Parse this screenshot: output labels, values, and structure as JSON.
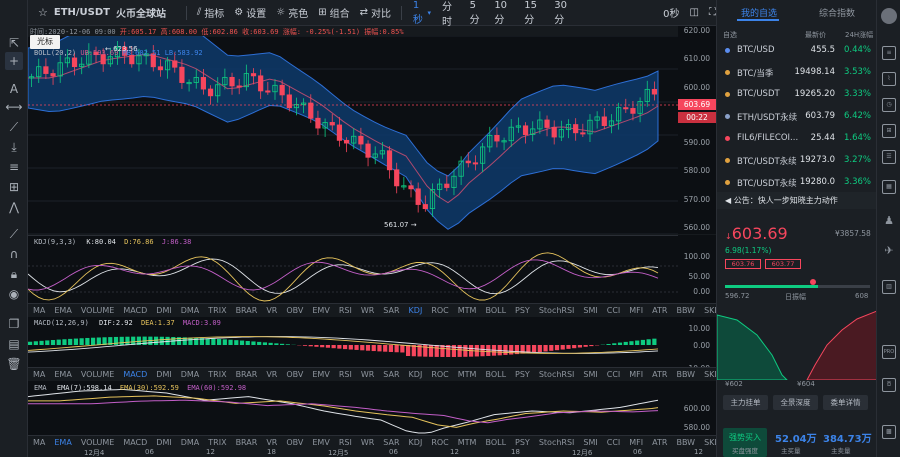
{
  "header": {
    "symbol": "ETH/USDT",
    "exchange": "火币全球站",
    "tools": [
      "指标",
      "设置",
      "亮色",
      "组合",
      "对比"
    ],
    "intervals": [
      "1秒",
      "分时",
      "5分",
      "10分",
      "15分",
      "30分"
    ],
    "active_interval": "1秒",
    "countdown": "0秒"
  },
  "ohlc": {
    "time_label": "时间:2020-12-06 09:00",
    "open_label": "开:605.17",
    "high_label": "高:608.00",
    "low_label": "低:602.86",
    "close_label": "收:603.69",
    "change_label": "涨幅: -0.25%(-1.51)",
    "amp_label": "振幅:0.85%"
  },
  "tooltip": "光标",
  "main_chart": {
    "legend_name": "BOLL(20,2)",
    "legend_up": "UB:593.69",
    "legend_mb": "MB:602.51",
    "legend_dn": "LB:583.92",
    "high_mark": "623.56",
    "low_mark": "561.07",
    "y_ticks": [
      "620.00",
      "610.00",
      "600.00",
      "590.00",
      "580.00",
      "570.00",
      "560.00"
    ],
    "price_tag": "603.69",
    "timer_tag": "00:22"
  },
  "kdj": {
    "legend_name": "KDJ(9,3,3)",
    "k": "K:80.04",
    "d": "D:76.86",
    "j": "J:86.38",
    "y_ticks": [
      "100.00",
      "50.00",
      "0.00"
    ]
  },
  "indicator_tabs": [
    "MA",
    "EMA",
    "VOLUME",
    "MACD",
    "DMI",
    "DMA",
    "TRIX",
    "BRAR",
    "VR",
    "OBV",
    "EMV",
    "RSI",
    "WR",
    "SAR",
    "KDJ",
    "ROC",
    "MTM",
    "BOLL",
    "PSY",
    "StochRSI",
    "SMI",
    "CCI",
    "MFI",
    "ATR",
    "BBW",
    "SKDJ",
    "BIAS",
    "DPO",
    "AO"
  ],
  "indicator_tabs_active": [
    "KDJ",
    "MACD",
    "EMA"
  ],
  "macd": {
    "legend_name": "MACD(12,26,9)",
    "dif": "DIF:2.92",
    "dea": "DEA:1.37",
    "macd": "MACD:3.09",
    "y_ticks": [
      "10.00",
      "0.00",
      "-10.00"
    ]
  },
  "ema": {
    "legend_name": "EMA",
    "ema7": "EMA(7):598.14",
    "ema30": "EMA(30):592.59",
    "ema60": "EMA(60):592.98",
    "y_ticks": [
      "600.00",
      "580.00"
    ]
  },
  "x_axis": [
    "12月4",
    "06",
    "12",
    "18",
    "12月5",
    "06",
    "12",
    "18",
    "12月6",
    "06",
    "12"
  ],
  "right_panel": {
    "tab_watchlist": "我的自选",
    "tab_index": "综合指数",
    "col_name": "自选",
    "col_price": "最新价",
    "col_change": "24H涨幅",
    "watchlist": [
      {
        "name": "BTC/USD",
        "price": "455.5",
        "change": "0.44%"
      },
      {
        "name": "BTC/当季",
        "price": "19498.14",
        "change": "3.53%"
      },
      {
        "name": "BTC/USDT",
        "price": "19265.20",
        "change": "3.33%"
      },
      {
        "name": "ETH/USDT永续",
        "price": "603.79",
        "change": "6.42%"
      },
      {
        "name": "FIL6/FILECOI...",
        "price": "25.44",
        "change": "1.64%"
      },
      {
        "name": "BTC/USDT永续",
        "price": "19273.0",
        "change": "3.27%"
      },
      {
        "name": "BTC/USDT永续",
        "price": "19280.0",
        "change": "3.36%"
      }
    ],
    "announcement": "公告：快人一步知晓主力动作",
    "big_price": "603.69",
    "big_price_currency": "¥3857.58",
    "change_line": "6.98(1.17%)",
    "bid_box": "603.76",
    "ask_box": "603.77",
    "range_low": "596.72",
    "range_label": "日振幅",
    "range_high": "608",
    "depth_left": "¥602",
    "depth_right": "¥604",
    "buttons": [
      "主力挂单",
      "全景深度",
      "委单详情"
    ],
    "strong_buy": "强势买入",
    "strong_buy_sub": "买盘强度",
    "vol1": "52.04万",
    "vol1_label": "主买量",
    "vol2": "384.73万",
    "vol2_label": "主卖量"
  },
  "colors": {
    "up": "#0ecb81",
    "down": "#f6465d",
    "accent": "#3c83e8",
    "band": "#0e3a6b"
  }
}
